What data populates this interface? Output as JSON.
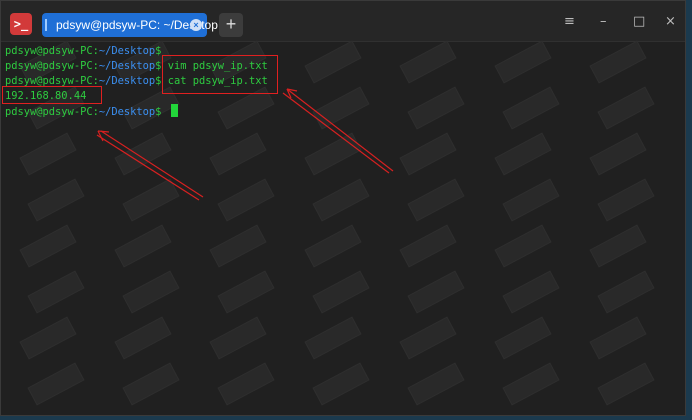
{
  "window": {
    "app_icon": "terminal-icon",
    "tab_title": "pdsyw@pdsyw-PC: ~/Desktop",
    "new_tab_label": "+",
    "controls": {
      "menu": "≡",
      "minimize": "–",
      "maximize": "□",
      "close": "×"
    }
  },
  "terminal": {
    "lines": [
      {
        "user": "pdsyw@pdsyw-PC",
        "sep": ":",
        "path": "~/Desktop",
        "dollar": "$",
        "cmd": ""
      },
      {
        "user": "pdsyw@pdsyw-PC",
        "sep": ":",
        "path": "~/Desktop",
        "dollar": "$",
        "cmd": " vim pdsyw_ip.txt"
      },
      {
        "user": "pdsyw@pdsyw-PC",
        "sep": ":",
        "path": "~/Desktop",
        "dollar": "$",
        "cmd": " cat pdsyw_ip.txt"
      },
      {
        "output": "192.168.80.44"
      },
      {
        "user": "pdsyw@pdsyw-PC",
        "sep": ":",
        "path": "~/Desktop",
        "dollar": "$",
        "cmd": " "
      }
    ]
  },
  "colors": {
    "prompt_user": "#2ecc40",
    "prompt_path": "#3b8ff0",
    "annotation": "#e02020",
    "tab_active": "#1f6fd6"
  }
}
